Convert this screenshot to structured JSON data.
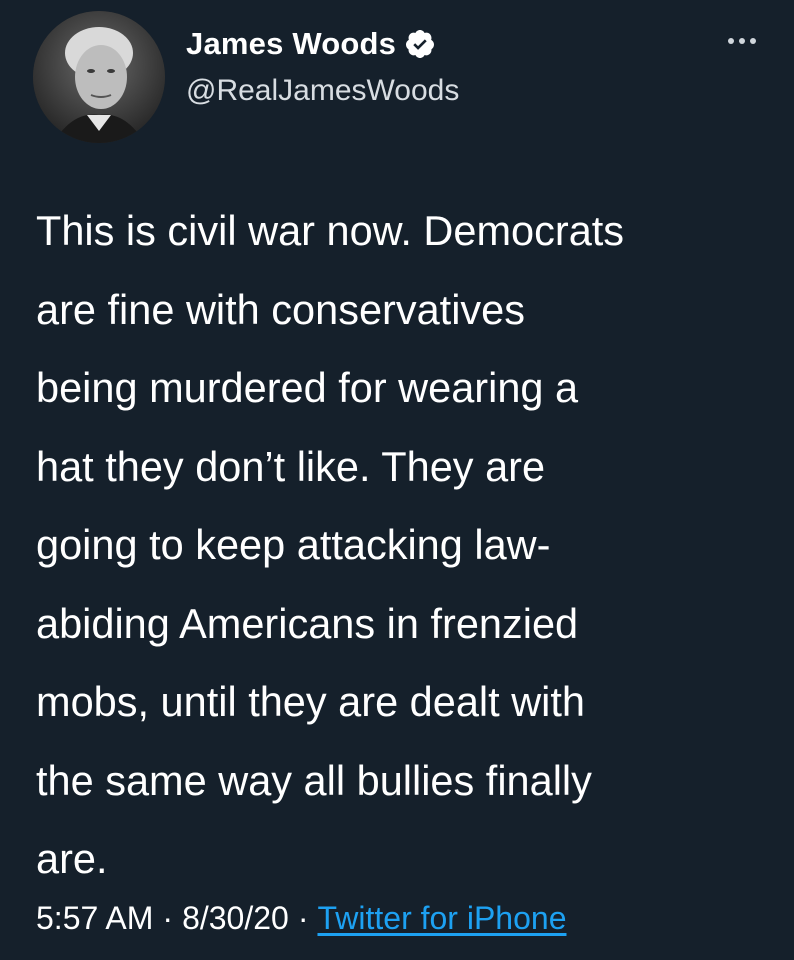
{
  "author": {
    "display_name": "James Woods",
    "handle": "@RealJamesWoods",
    "verified": true,
    "avatar_icon": "profile-photo"
  },
  "menu": {
    "icon": "more-horizontal-icon"
  },
  "tweet": {
    "text": "This is civil war now. Democrats\nare fine with conservatives\nbeing murdered for wearing a\nhat they don’t like. They are\ngoing to keep attacking law-\nabiding Americans in frenzied\nmobs, until they are dealt with\nthe same way all bullies finally\nare."
  },
  "meta": {
    "time": "5:57 AM",
    "separator": "·",
    "date": "8/30/20",
    "source": "Twitter for iPhone"
  },
  "colors": {
    "background": "#15202b",
    "text": "#ffffff",
    "link": "#1da1f2"
  }
}
